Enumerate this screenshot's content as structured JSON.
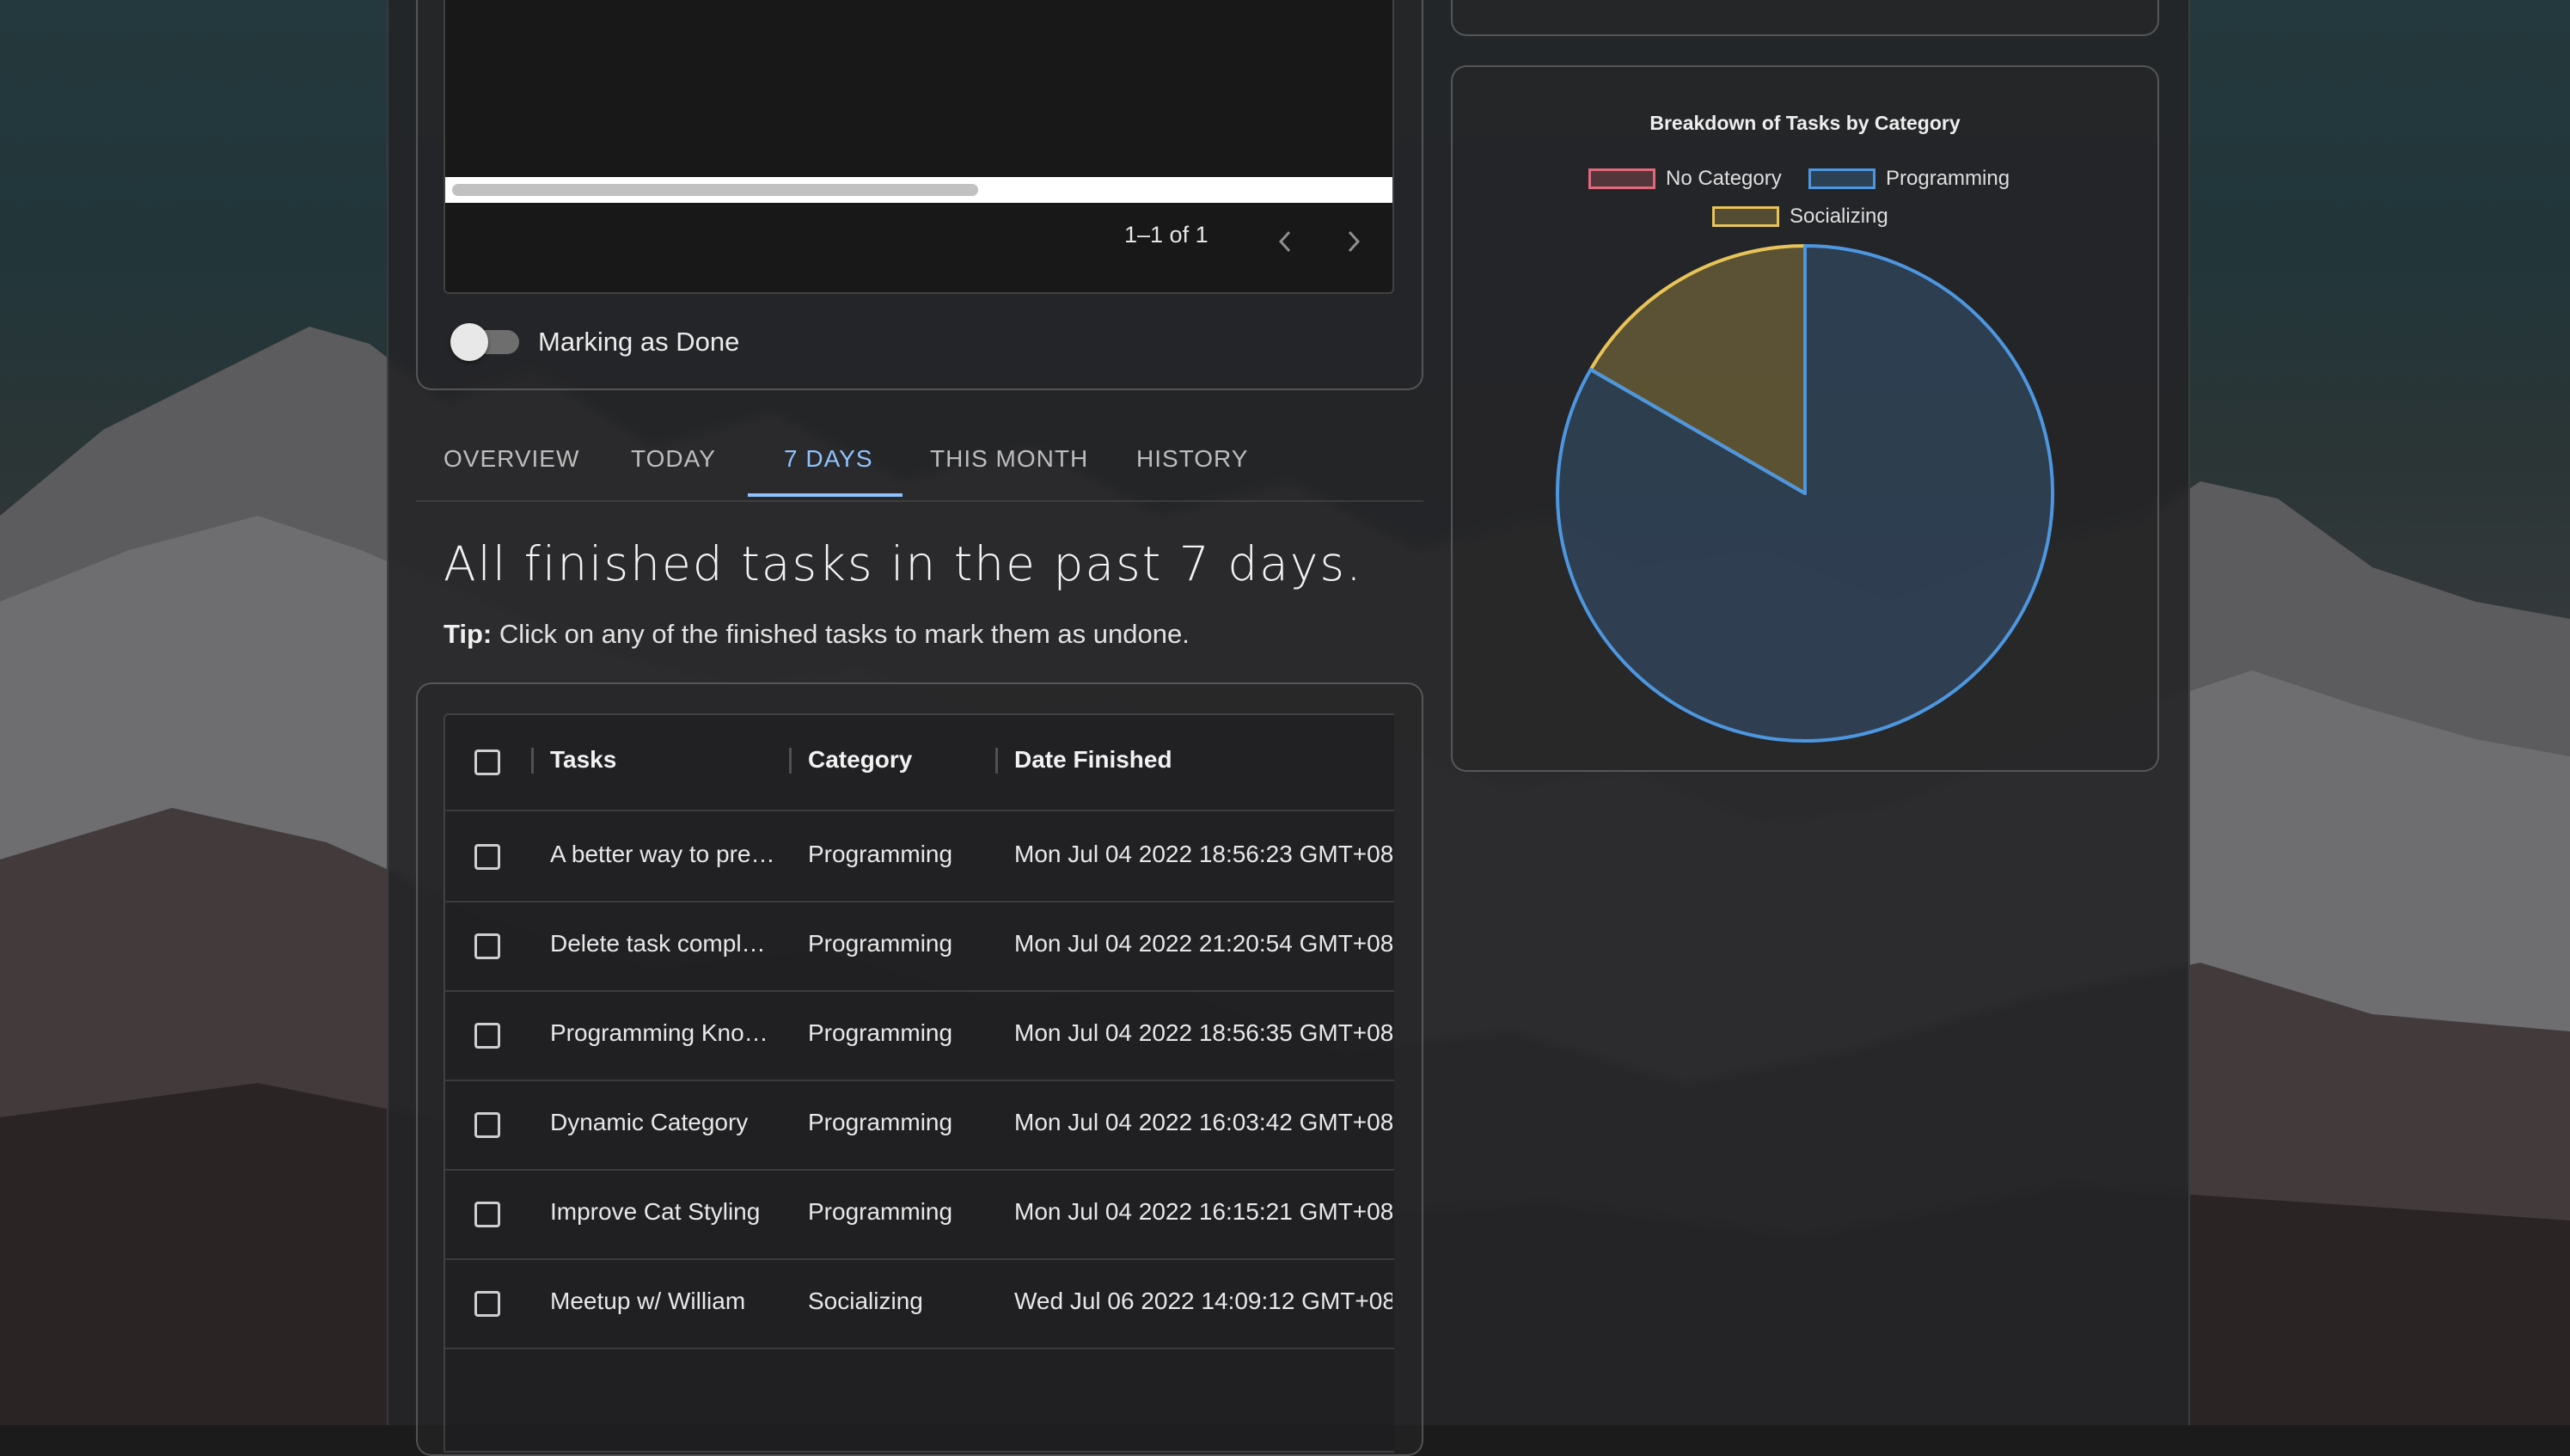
{
  "pagination": {
    "range": "1–1 of 1",
    "prev_icon": "chevron-left",
    "next_icon": "chevron-right"
  },
  "toggle": {
    "label": "Marking as Done",
    "checked": false
  },
  "tabs": [
    {
      "label": "OVERVIEW",
      "active": false
    },
    {
      "label": "TODAY",
      "active": false
    },
    {
      "label": "7 DAYS",
      "active": true
    },
    {
      "label": "THIS MONTH",
      "active": false
    },
    {
      "label": "HISTORY",
      "active": false
    }
  ],
  "headline": "All finished tasks in the past 7 days.",
  "tip": {
    "prefix": "Tip:",
    "text": " Click on any of the finished tasks to mark them as undone."
  },
  "table": {
    "columns": [
      "Tasks",
      "Category",
      "Date Finished"
    ],
    "rows": [
      {
        "task": "A better way to pre…",
        "category": "Programming",
        "date": "Mon Jul 04 2022 18:56:23 GMT+08"
      },
      {
        "task": "Delete task compl…",
        "category": "Programming",
        "date": "Mon Jul 04 2022 21:20:54 GMT+08"
      },
      {
        "task": "Programming Kno…",
        "category": "Programming",
        "date": "Mon Jul 04 2022 18:56:35 GMT+08"
      },
      {
        "task": "Dynamic Category",
        "category": "Programming",
        "date": "Mon Jul 04 2022 16:03:42 GMT+08"
      },
      {
        "task": "Improve Cat Styling",
        "category": "Programming",
        "date": "Mon Jul 04 2022 16:15:21 GMT+08"
      },
      {
        "task": "Meetup w/ William",
        "category": "Socializing",
        "date": "Wed Jul 06 2022 14:09:12 GMT+08"
      }
    ]
  },
  "colors": {
    "accent": "#8fc2ff",
    "no_category": "#e06a7c",
    "programming": "#4d97e0",
    "socializing": "#e8c458"
  },
  "chart_data": {
    "type": "pie",
    "title": "Breakdown of Tasks by Category",
    "legend_position": "top",
    "categories": [
      "No Category",
      "Programming",
      "Socializing"
    ],
    "values": [
      0,
      5,
      1
    ],
    "colors": [
      "#e06a7c",
      "#4d97e0",
      "#e8c458"
    ]
  }
}
